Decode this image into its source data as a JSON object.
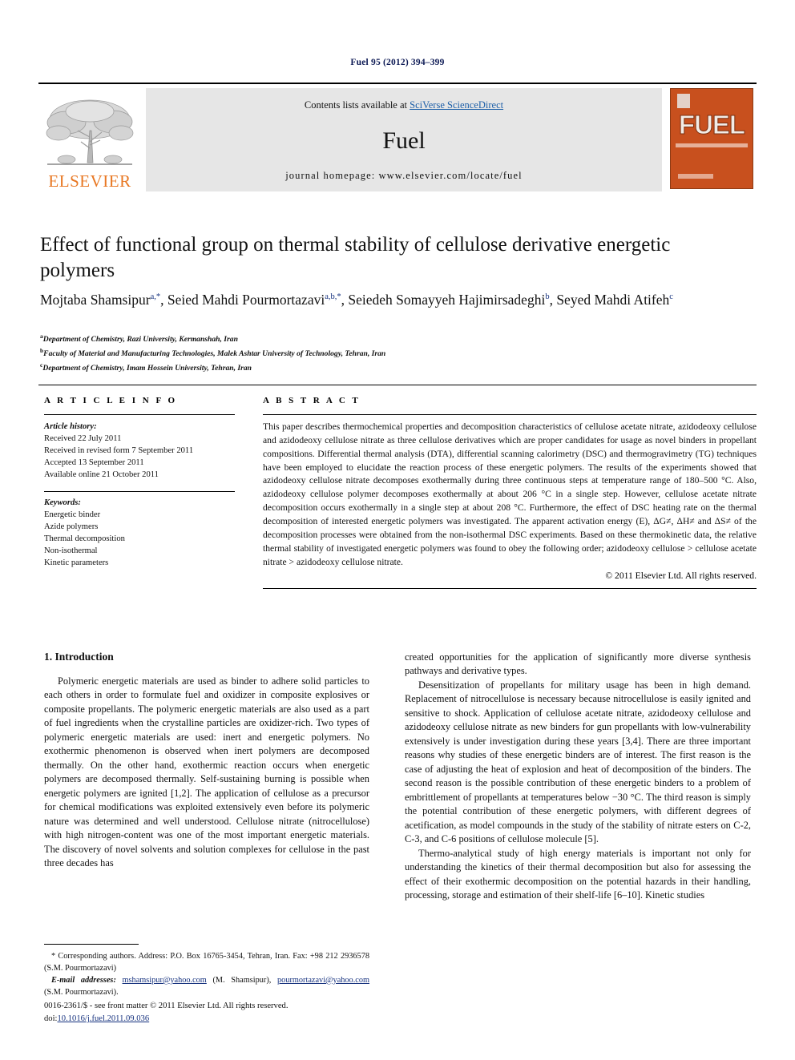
{
  "running_head": "Fuel 95 (2012) 394–399",
  "banner": {
    "publisher_name": "ELSEVIER",
    "contents_prefix": "Contents lists available at ",
    "contents_link": "SciVerse ScienceDirect",
    "journal_name": "Fuel",
    "homepage": "journal homepage: www.elsevier.com/locate/fuel",
    "cover_title": "FUEL",
    "link_color": "#1d5fa8",
    "cover_color": "#C8501E",
    "elsevier_orange": "#E87722"
  },
  "article": {
    "title": "Effect of functional group on thermal stability of cellulose derivative energetic polymers",
    "authors": [
      {
        "name": "Mojtaba Shamsipur",
        "sup": "a,*"
      },
      {
        "name": "Seied Mahdi Pourmortazavi",
        "sup": "a,b,*"
      },
      {
        "name": "Seiedeh Somayyeh Hajimirsadeghi",
        "sup": "b"
      },
      {
        "name": "Seyed Mahdi Atifeh",
        "sup": "c"
      }
    ],
    "affiliations": [
      {
        "mark": "a",
        "text": "Department of Chemistry, Razi University, Kermanshah, Iran"
      },
      {
        "mark": "b",
        "text": "Faculty of Material and Manufacturing Technologies, Malek Ashtar University of Technology, Tehran, Iran"
      },
      {
        "mark": "c",
        "text": "Department of Chemistry, Imam Hossein University, Tehran, Iran"
      }
    ]
  },
  "article_info": {
    "heading": "A R T I C L E    I N F O",
    "history_label": "Article history:",
    "history": [
      "Received 22 July 2011",
      "Received in revised form 7 September 2011",
      "Accepted 13 September 2011",
      "Available online 21 October 2011"
    ],
    "keywords_label": "Keywords:",
    "keywords": [
      "Energetic binder",
      "Azide polymers",
      "Thermal decomposition",
      "Non-isothermal",
      "Kinetic parameters"
    ]
  },
  "abstract": {
    "heading": "A B S T R A C T",
    "text": "This paper describes thermochemical properties and decomposition characteristics of cellulose acetate nitrate, azidodeoxy cellulose and azidodeoxy cellulose nitrate as three cellulose derivatives which are proper candidates for usage as novel binders in propellant compositions. Differential thermal analysis (DTA), differential scanning calorimetry (DSC) and thermogravimetry (TG) techniques have been employed to elucidate the reaction process of these energetic polymers. The results of the experiments showed that azidodeoxy cellulose nitrate decomposes exothermally during three continuous steps at temperature range of 180–500 °C. Also, azidodeoxy cellulose polymer decomposes exothermally at about 206 °C in a single step. However, cellulose acetate nitrate decomposition occurs exothermally in a single step at about 208 °C. Furthermore, the effect of DSC heating rate on the thermal decomposition of interested energetic polymers was investigated. The apparent activation energy (E), ΔG≠, ΔH≠ and ΔS≠ of the decomposition processes were obtained from the non-isothermal DSC experiments. Based on these thermokinetic data, the relative thermal stability of investigated energetic polymers was found to obey the following order; azidodeoxy cellulose > cellulose acetate nitrate > azidodeoxy cellulose nitrate.",
    "copyright": "© 2011 Elsevier Ltd. All rights reserved."
  },
  "body": {
    "section_number_title": "1. Introduction",
    "left_paragraphs": [
      "Polymeric energetic materials are used as binder to adhere solid particles to each others in order to formulate fuel and oxidizer in composite explosives or composite propellants. The polymeric energetic materials are also used as a part of fuel ingredients when the crystalline particles are oxidizer-rich. Two types of polymeric energetic materials are used: inert and energetic polymers. No exothermic phenomenon is observed when inert polymers are decomposed thermally. On the other hand, exothermic reaction occurs when energetic polymers are decomposed thermally. Self-sustaining burning is possible when energetic polymers are ignited [1,2]. The application of cellulose as a precursor for chemical modifications was exploited extensively even before its polymeric nature was determined and well understood. Cellulose nitrate (nitrocellulose) with high nitrogen-content was one of the most important energetic materials. The discovery of novel solvents and solution complexes for cellulose in the past three decades has"
    ],
    "right_paragraphs": [
      "created opportunities for the application of significantly more diverse synthesis pathways and derivative types.",
      "Desensitization of propellants for military usage has been in high demand. Replacement of nitrocellulose is necessary because nitrocellulose is easily ignited and sensitive to shock. Application of cellulose acetate nitrate, azidodeoxy cellulose and azidodeoxy cellulose nitrate as new binders for gun propellants with low-vulnerability extensively is under investigation during these years [3,4]. There are three important reasons why studies of these energetic binders are of interest. The first reason is the case of adjusting the heat of explosion and heat of decomposition of the binders. The second reason is the possible contribution of these energetic binders to a problem of embrittlement of propellants at temperatures below −30 °C. The third reason is simply the potential contribution of these energetic polymers, with different degrees of acetification, as model compounds in the study of the stability of nitrate esters on C-2, C-3, and C-6 positions of cellulose molecule [5].",
      "Thermo-analytical study of high energy materials is important not only for understanding the kinetics of their thermal decomposition but also for assessing the effect of their exothermic decomposition on the potential hazards in their handling, processing, storage and estimation of their shelf-life [6–10]. Kinetic studies"
    ]
  },
  "footnotes": {
    "corresponding": "* Corresponding authors. Address: P.O. Box 16765-3454, Tehran, Iran. Fax: +98 212 2936578 (S.M. Pourmortazavi)",
    "email_label": "E-mail addresses:",
    "email_1": "mshamsipur@yahoo.com",
    "email_1_owner": "(M. Shamsipur),",
    "email_2": "pourmortazavi@yahoo.com",
    "email_2_owner": "(S.M. Pourmortazavi)."
  },
  "footer": {
    "issn_line": "0016-2361/$ - see front matter © 2011 Elsevier Ltd. All rights reserved.",
    "doi_prefix": "doi:",
    "doi": "10.1016/j.fuel.2011.09.036"
  }
}
